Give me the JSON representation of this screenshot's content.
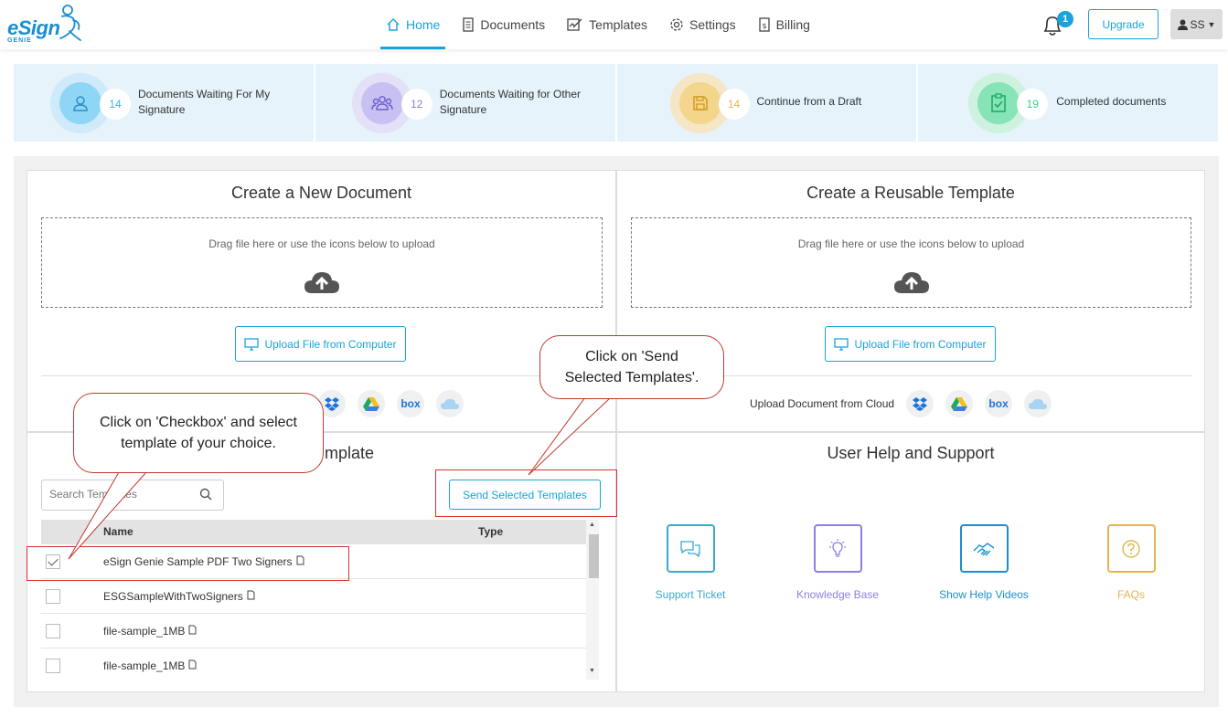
{
  "app": {
    "logo_text": "eSign",
    "logo_sub": "GENIE"
  },
  "nav": {
    "items": [
      {
        "label": "Home",
        "icon": "home-icon",
        "active": true
      },
      {
        "label": "Documents",
        "icon": "document-icon",
        "active": false
      },
      {
        "label": "Templates",
        "icon": "template-icon",
        "active": false
      },
      {
        "label": "Settings",
        "icon": "gear-icon",
        "active": false
      },
      {
        "label": "Billing",
        "icon": "billing-icon",
        "active": false
      }
    ],
    "notifications_count": "1",
    "upgrade_label": "Upgrade",
    "user_initials": "SS"
  },
  "stats": [
    {
      "count": "14",
      "label": "Documents Waiting For My Signature",
      "icon": "user-icon",
      "color": "#3bb3e8"
    },
    {
      "count": "12",
      "label": "Documents Waiting for Other Signature",
      "icon": "users-icon",
      "color": "#8b7de0"
    },
    {
      "count": "14",
      "label": "Continue from a Draft",
      "icon": "save-icon",
      "color": "#e8b74a"
    },
    {
      "count": "19",
      "label": "Completed documents",
      "icon": "clipboard-check-icon",
      "color": "#3ecf8e"
    }
  ],
  "create_doc": {
    "title": "Create a New Document",
    "drop_text": "Drag file here or use the icons below to upload",
    "upload_label": "Upload File from Computer"
  },
  "create_template": {
    "title": "Create a Reusable Template",
    "drop_text": "Drag file here or use the icons below to upload",
    "upload_label": "Upload File from Computer",
    "cloud_label": "Upload Document from Cloud"
  },
  "templates": {
    "title_visible": "mplate",
    "search_placeholder": "Search Templates",
    "send_label": "Send Selected Templates",
    "columns": [
      "Name",
      "Type"
    ],
    "rows": [
      {
        "name": "eSign Genie Sample PDF Two Signers",
        "checked": true
      },
      {
        "name": "ESGSampleWithTwoSigners",
        "checked": false
      },
      {
        "name": "file-sample_1MB",
        "checked": false
      },
      {
        "name": "file-sample_1MB",
        "checked": false
      }
    ]
  },
  "help": {
    "title": "User Help and Support",
    "items": [
      {
        "label": "Support Ticket",
        "icon": "chat-icon",
        "color": "#3aa9cc"
      },
      {
        "label": "Knowledge Base",
        "icon": "lightbulb-icon",
        "color": "#8f7fe0"
      },
      {
        "label": "Show Help Videos",
        "icon": "handshake-icon",
        "color": "#1a8fd0"
      },
      {
        "label": "FAQs",
        "icon": "question-icon",
        "color": "#e3b54d"
      }
    ]
  },
  "callouts": {
    "checkbox_line1": "Click on 'Checkbox' and select",
    "checkbox_line2": "template of your choice.",
    "send_line1": "Click on 'Send",
    "send_line2": "Selected Templates'."
  }
}
